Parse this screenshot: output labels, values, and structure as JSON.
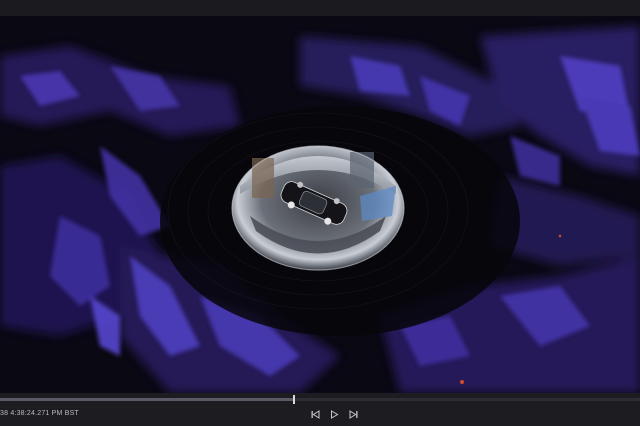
{
  "playback": {
    "timestamp": "38 4:38:24.271 PM BST",
    "progress": 0.46
  },
  "controls": {
    "step_back_icon": "step-backward-icon",
    "play_icon": "play-icon",
    "step_forward_icon": "step-forward-icon"
  },
  "colors": {
    "point_cloud": "#5b45c8",
    "point_cloud_bright": "#8b7cf0",
    "background": "#08070d",
    "ui_bar": "#1c1c21"
  }
}
